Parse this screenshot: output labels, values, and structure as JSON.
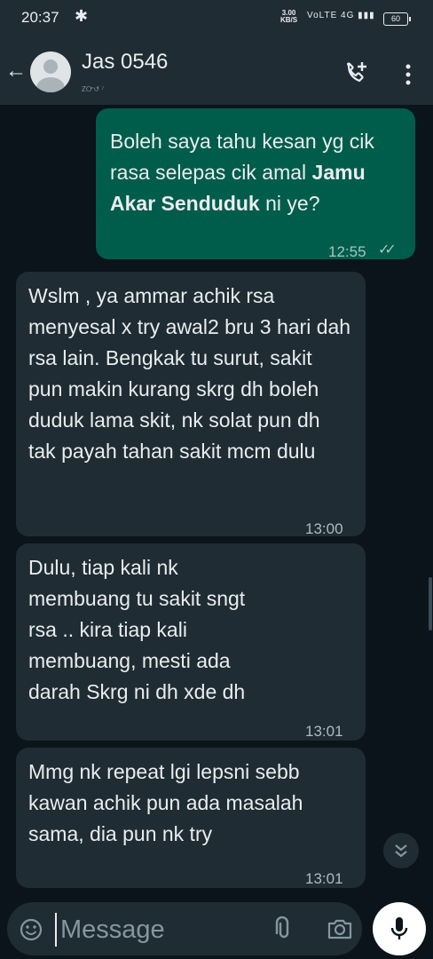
{
  "status_bar": {
    "time": "20:37",
    "fan_glyph": "✱",
    "speed_value": "3.00",
    "speed_unit": "KB/S",
    "network": "VoLTE 4G ▮▮▮",
    "battery": "60"
  },
  "header": {
    "back_icon": "arrow-left",
    "contact_name": "Jas 0546",
    "contact_subtitle": "ᏃᏅ↺          ⁷",
    "icons": [
      "add-call-icon",
      "overflow-menu-icon"
    ]
  },
  "messages": [
    {
      "direction": "out",
      "text_before": "Boleh saya tahu kesan yg cik rasa selepas cik amal ",
      "text_bold": "Jamu Akar Senduduk",
      "text_after": " ni ye?",
      "time": "12:55",
      "read_receipt": "✓✓"
    },
    {
      "direction": "in",
      "text": "Wslm , ya ammar achik rsa menyesal x try awal2 bru 3 hari dah rsa lain. Bengkak tu surut, sakit pun makin kurang skrg dh boleh duduk lama skit, nk solat pun dh tak payah tahan sakit mcm dulu",
      "time": "13:00"
    },
    {
      "direction": "in",
      "text": "Dulu, tiap kali nk membuang tu sakit sngt rsa .. kira tiap kali membuang, mesti ada darah  Skrg ni dh xde dh",
      "time": "13:01"
    },
    {
      "direction": "in",
      "text": "Mmg nk repeat lgi lepsni sebb kawan achik pun ada masalah sama, dia pun nk try",
      "time": "13:01"
    }
  ],
  "scroll_down_icon": "double-chevron-down",
  "input_bar": {
    "placeholder": "Message",
    "icons": [
      "emoji-icon",
      "attach-icon",
      "camera-icon",
      "mic-icon"
    ]
  },
  "colors": {
    "background": "#0b141a",
    "bar": "#1f2c34",
    "outgoing_bubble": "#005c4b",
    "incoming_bubble": "#1f2c34",
    "text": "#e9edef",
    "muted": "#8696a0"
  }
}
